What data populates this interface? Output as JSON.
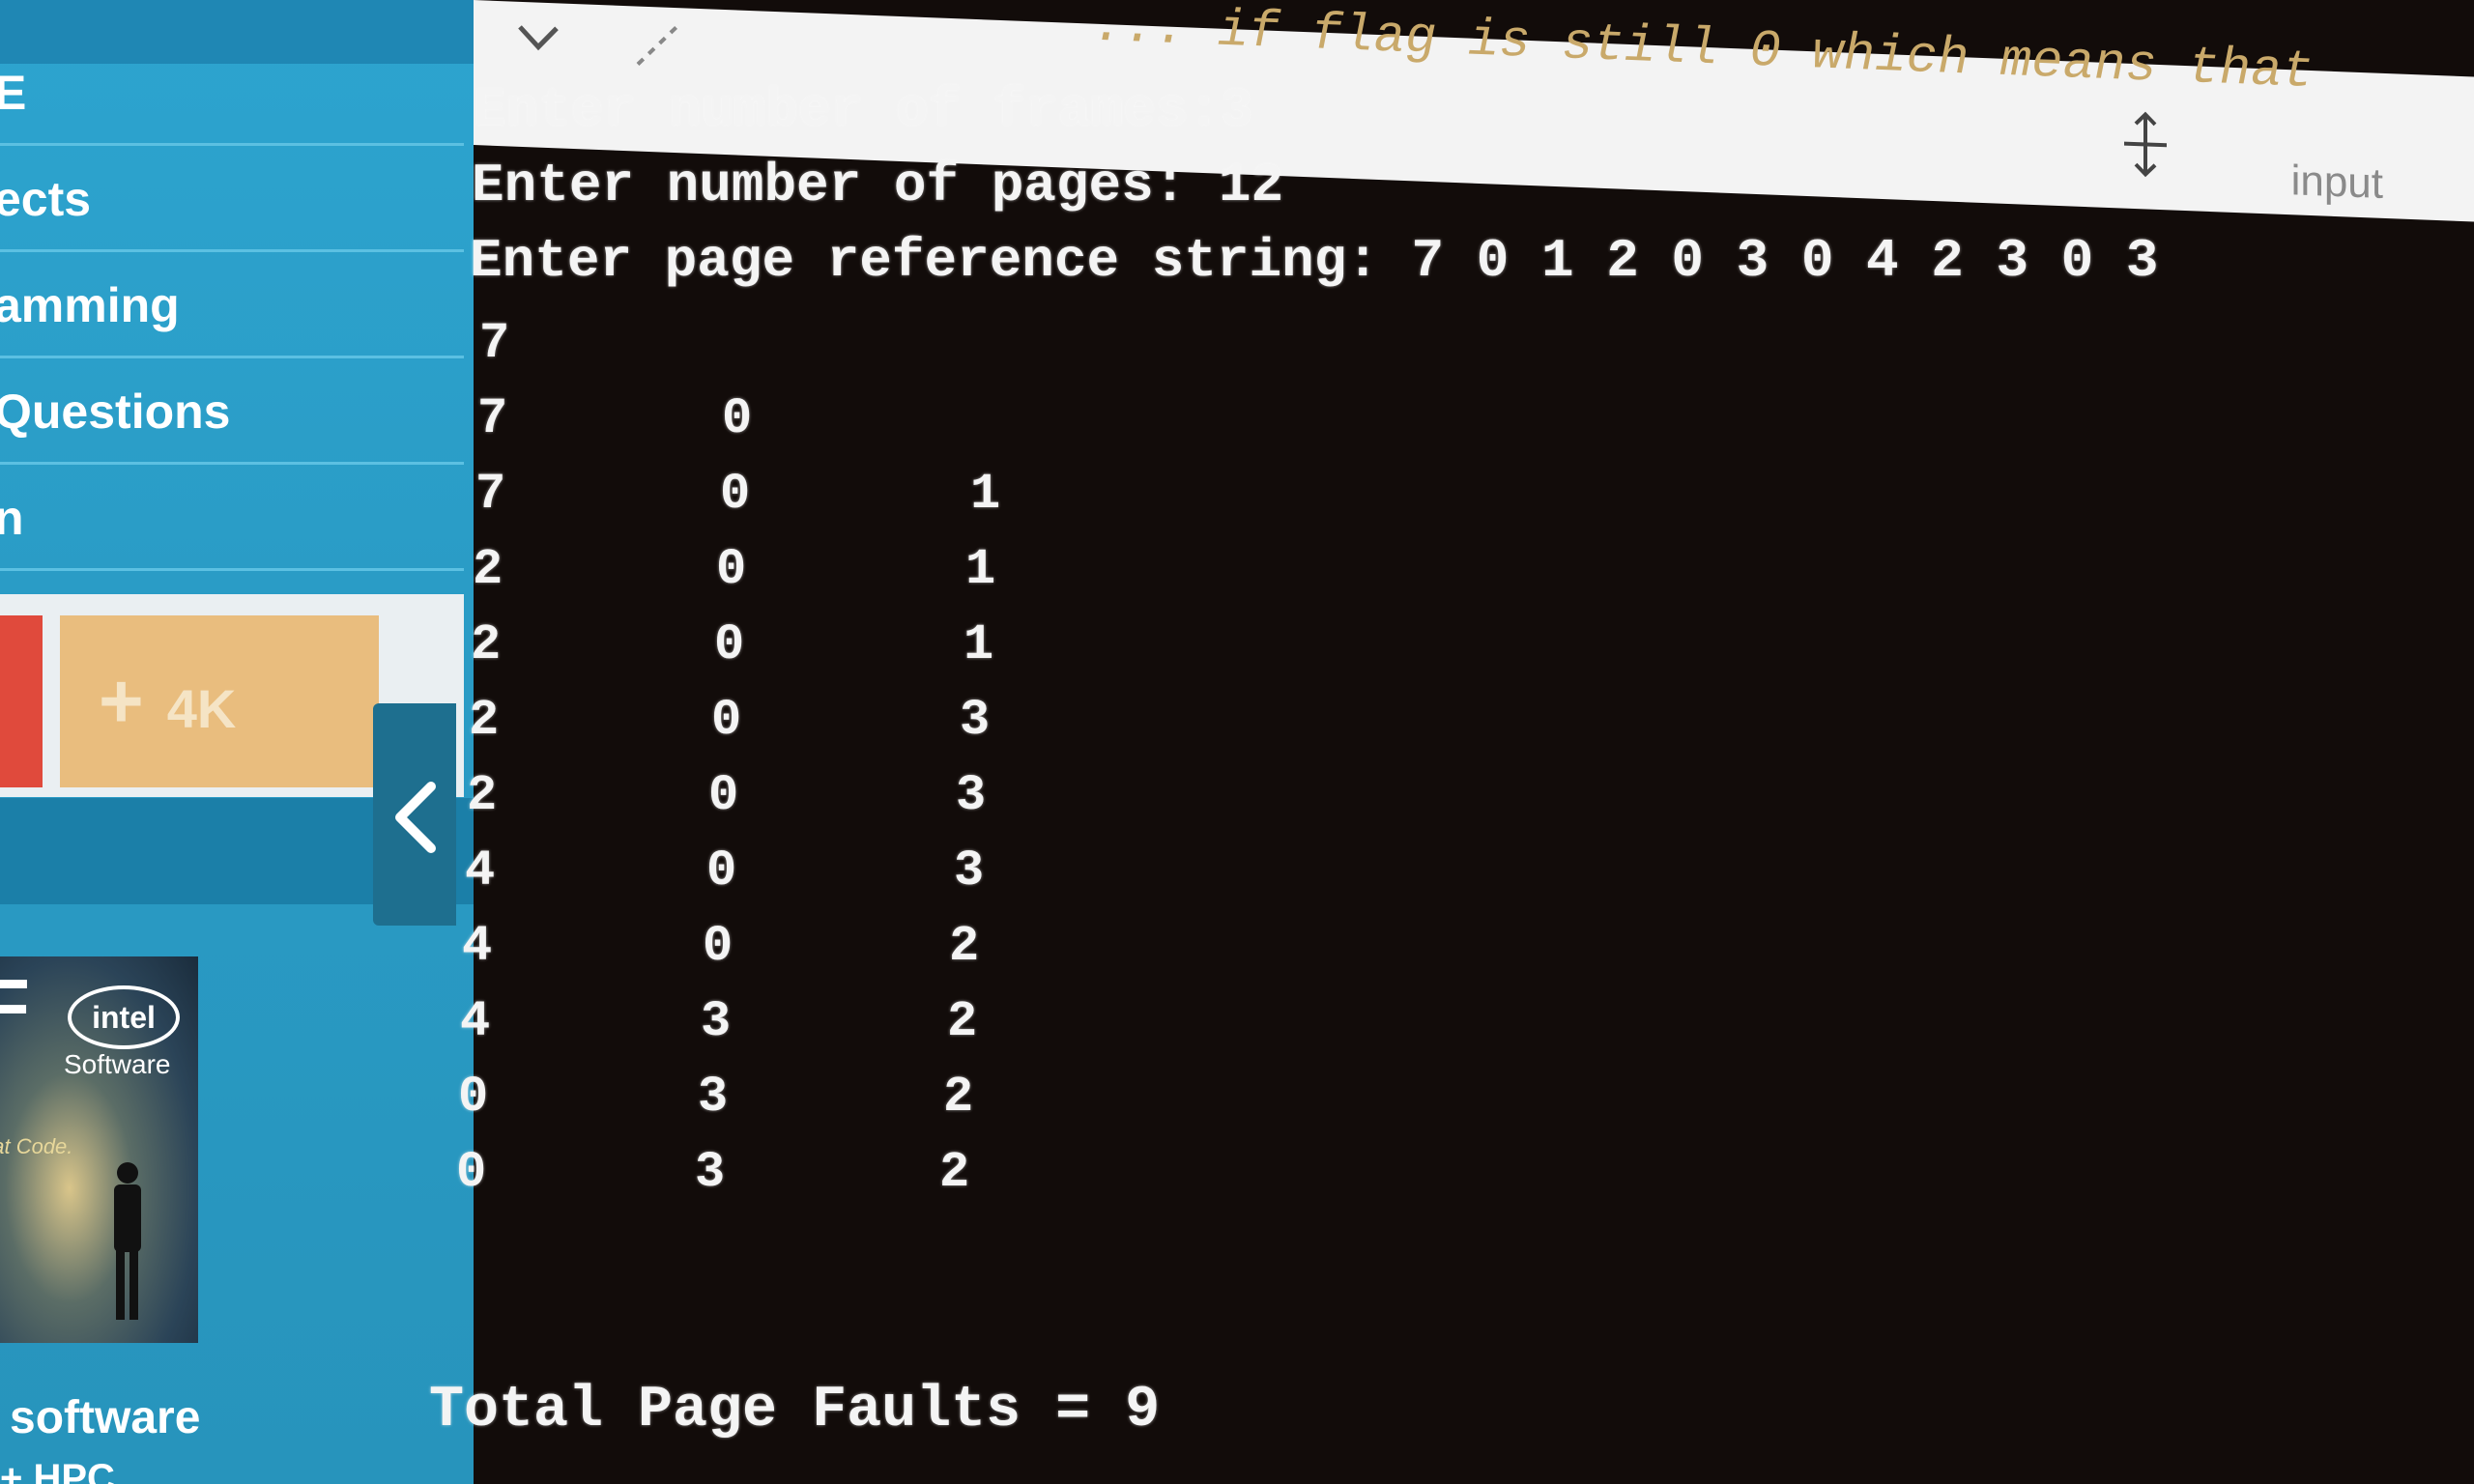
{
  "sidebar": {
    "nav_items": [
      {
        "label": "E"
      },
      {
        "label": "ects"
      },
      {
        "label": "amming"
      },
      {
        "label": "Questions"
      },
      {
        "label": "n"
      }
    ],
    "tiles": {
      "plus": "+",
      "count": "4K"
    },
    "ad": {
      "letter": "F",
      "brand": "intel",
      "sub": "Software",
      "tagline": "eat Code."
    },
    "footer": "software",
    "footer_cut": "+ HPC"
  },
  "editor": {
    "code_peek": "... if flag is still 0 which means that",
    "input_label": "input"
  },
  "terminal": {
    "prompt_frames": "Enter number of frames:3",
    "prompt_pages": "Enter number of pages: 12",
    "prompt_refs": "Enter page reference string: 7 0 1 2 0 3 0 4 2 3 0 3",
    "rows": [
      [
        "7",
        "",
        ""
      ],
      [
        "7",
        "0",
        ""
      ],
      [
        "7",
        "0",
        "1"
      ],
      [
        "2",
        "0",
        "1"
      ],
      [
        "2",
        "0",
        "1"
      ],
      [
        "2",
        "0",
        "3"
      ],
      [
        "2",
        "0",
        "3"
      ],
      [
        "4",
        "0",
        "3"
      ],
      [
        "4",
        "0",
        "2"
      ],
      [
        "4",
        "3",
        "2"
      ],
      [
        "0",
        "3",
        "2"
      ],
      [
        "0",
        "3",
        "2"
      ]
    ],
    "total": "Total Page Faults = 9"
  },
  "colors": {
    "sidebar_blue": "#2a9cc6",
    "terminal_bg": "#120c0a",
    "terminal_text": "#f4f4f4",
    "tile_red": "#e04a3c",
    "tile_orange": "#e9bd7e"
  },
  "icons": [
    "chevron-down-icon",
    "expand-icon",
    "resize-icon",
    "chevron-left-icon"
  ]
}
